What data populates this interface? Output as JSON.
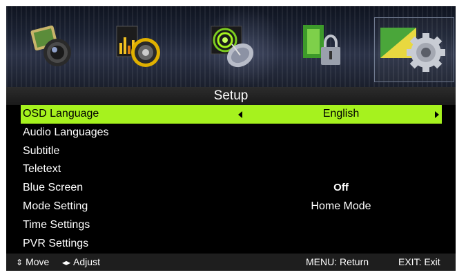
{
  "menu": {
    "title": "Setup",
    "tabs": [
      {
        "name": "picture-icon"
      },
      {
        "name": "sound-icon"
      },
      {
        "name": "channel-icon"
      },
      {
        "name": "lock-icon"
      },
      {
        "name": "setup-gear-icon",
        "selected": true
      }
    ],
    "items": [
      {
        "label": "OSD Language",
        "value": "English",
        "selected": true
      },
      {
        "label": "Audio Languages",
        "value": ""
      },
      {
        "label": "Subtitle",
        "value": ""
      },
      {
        "label": "Teletext",
        "value": ""
      },
      {
        "label": "Blue Screen",
        "value": "Off"
      },
      {
        "label": "Mode Setting",
        "value": "Home Mode"
      },
      {
        "label": "Time Settings",
        "value": ""
      },
      {
        "label": "PVR Settings",
        "value": ""
      }
    ]
  },
  "footer": {
    "move_icon": "up-down-arrows-icon",
    "move": "Move",
    "adjust_icon": "left-right-arrows-icon",
    "adjust": "Adjust",
    "menu": "MENU: Return",
    "exit": "EXIT: Exit"
  },
  "colors": {
    "highlight": "#a6f21e",
    "background": "#000000",
    "text": "#ffffff"
  }
}
